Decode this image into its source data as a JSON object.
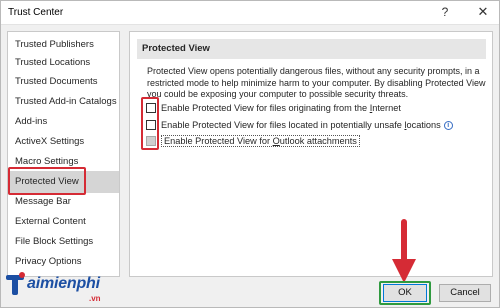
{
  "window": {
    "title": "Trust Center",
    "help_glyph": "?",
    "close_glyph": "✕"
  },
  "sidebar": {
    "items": [
      {
        "label": "Trusted Publishers"
      },
      {
        "label": "Trusted Locations"
      },
      {
        "label": "Trusted Documents"
      },
      {
        "label": "Trusted Add-in Catalogs"
      },
      {
        "label": "Add-ins"
      },
      {
        "label": "ActiveX Settings"
      },
      {
        "label": "Macro Settings"
      },
      {
        "label": "Protected View"
      },
      {
        "label": "Message Bar"
      },
      {
        "label": "External Content"
      },
      {
        "label": "File Block Settings"
      },
      {
        "label": "Privacy Options"
      }
    ],
    "selected_index": 7
  },
  "main": {
    "section_title": "Protected View",
    "description": "Protected View opens potentially dangerous files, without any security prompts, in a restricted mode to help minimize harm to your computer. By disabling Protected View you could be exposing your computer to possible security threats.",
    "options": [
      {
        "label_pre": "Enable Protected View for files originating from the ",
        "label_access": "I",
        "label_post": "nternet",
        "checked": false,
        "disabled": false
      },
      {
        "label_pre": "Enable Protected View for files located in potentially unsafe ",
        "label_access": "l",
        "label_post": "ocations",
        "checked": false,
        "disabled": false,
        "has_info": true
      },
      {
        "label_pre": "Enable Protected View for ",
        "label_access": "O",
        "label_post": "utlook attachments",
        "checked": false,
        "disabled": true
      }
    ],
    "info_glyph": "i"
  },
  "buttons": {
    "ok": "OK",
    "cancel": "Cancel"
  },
  "watermark": {
    "brand": "aimienphi",
    "suffix": ".vn"
  },
  "colors": {
    "highlight_red": "#d52b35",
    "highlight_green": "#2f9a3f",
    "selected_bg": "#d5d5d5",
    "brand_blue": "#1c4fa3"
  }
}
